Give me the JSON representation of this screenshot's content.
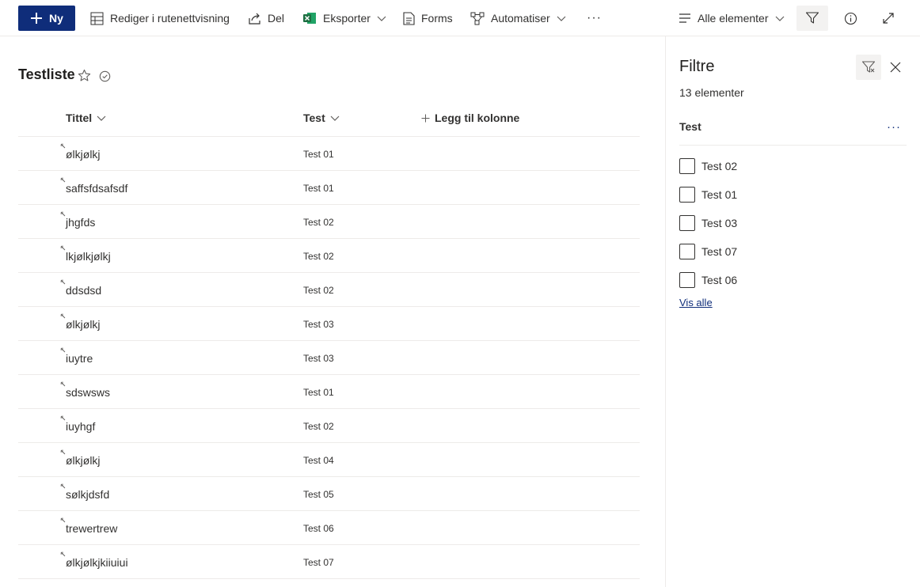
{
  "toolbar": {
    "new_label": "Ny",
    "edit_grid_label": "Rediger i rutenettvisning",
    "share_label": "Del",
    "export_label": "Eksporter",
    "forms_label": "Forms",
    "automate_label": "Automatiser",
    "more_label": "···",
    "view_label": "Alle elementer",
    "icons": {
      "new": "plus-icon",
      "grid": "grid-icon",
      "share": "share-icon",
      "export": "excel-icon",
      "forms": "forms-icon",
      "automate": "flow-icon",
      "view": "lines-icon",
      "filter": "filter-icon",
      "info": "info-icon",
      "expand": "expand-icon"
    },
    "colors": {
      "primary": "#0f2d7a",
      "excel": "#1d6f42"
    }
  },
  "list": {
    "title": "Testliste",
    "columns": {
      "title": "Tittel",
      "test": "Test",
      "add": "Legg til kolonne"
    },
    "rows": [
      {
        "title": "ølkjølkj",
        "test": "Test 01"
      },
      {
        "title": "saffsfdsafsdf",
        "test": "Test 01"
      },
      {
        "title": "jhgfds",
        "test": "Test 02"
      },
      {
        "title": "lkjølkjølkj",
        "test": "Test 02"
      },
      {
        "title": "ddsdsd",
        "test": "Test 02"
      },
      {
        "title": "ølkjølkj",
        "test": "Test 03"
      },
      {
        "title": "iuytre",
        "test": "Test 03"
      },
      {
        "title": "sdswsws",
        "test": "Test 01"
      },
      {
        "title": "iuyhgf",
        "test": "Test 02"
      },
      {
        "title": "ølkjølkj",
        "test": "Test 04"
      },
      {
        "title": "sølkjdsfd",
        "test": "Test 05"
      },
      {
        "title": "trewertrew",
        "test": "Test 06"
      },
      {
        "title": "ølkjølkjkiiuiui",
        "test": "Test 07"
      }
    ]
  },
  "filter_pane": {
    "title": "Filtre",
    "count": "13 elementer",
    "section": "Test",
    "more_label": "···",
    "options": [
      {
        "label": "Test 02",
        "checked": false
      },
      {
        "label": "Test 01",
        "checked": false
      },
      {
        "label": "Test 03",
        "checked": false
      },
      {
        "label": "Test 07",
        "checked": false
      },
      {
        "label": "Test 06",
        "checked": false
      }
    ],
    "show_all": "Vis alle"
  }
}
